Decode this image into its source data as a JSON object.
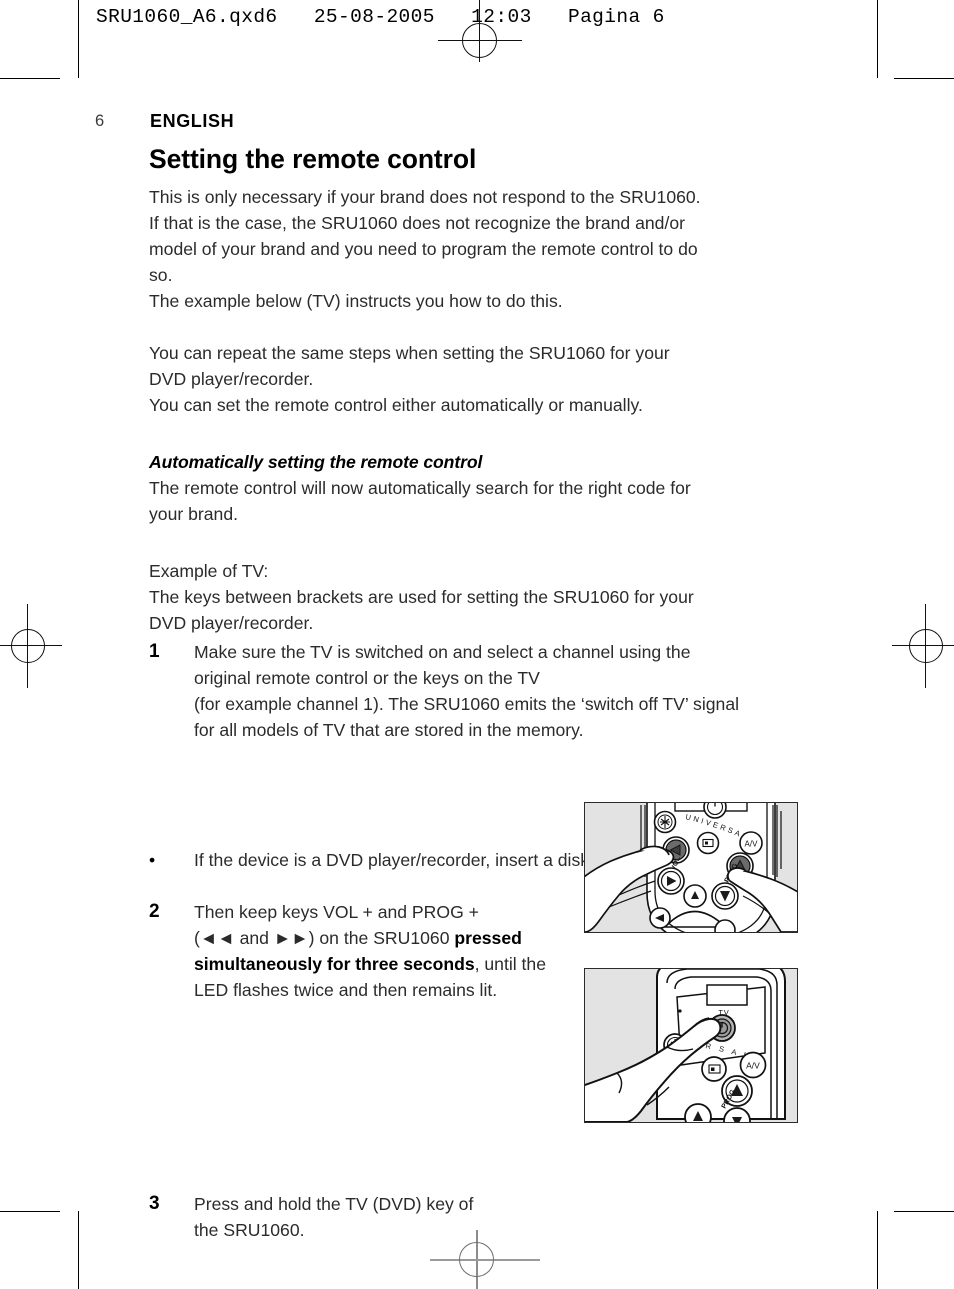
{
  "running_head": "SRU1060_A6.qxd6   25-08-2005   12:03   Pagina 6",
  "page": {
    "folio": "6",
    "language": "ENGLISH",
    "title": "Setting the remote control"
  },
  "body": {
    "intro_lines": [
      "This is only necessary if your brand does not respond to the SRU1060.",
      "If that is the case, the SRU1060 does not recognize the brand and/or",
      "model of your brand and you need to program the remote control to do",
      "so.",
      "The example below (TV) instructs you how to do this."
    ],
    "repeat_lines": [
      "You can repeat the same steps when setting the SRU1060 for your",
      "DVD player/recorder.",
      "You can set the remote control either automatically or manually."
    ],
    "subheading": "Automatically setting the remote control",
    "auto_lines": [
      "The remote control will now automatically search for the right code for",
      "your brand."
    ],
    "example_lines": [
      "Example of TV:",
      "The keys between brackets are used for setting the SRU1060 for your",
      "DVD player/recorder."
    ]
  },
  "steps": [
    {
      "marker": "1",
      "type": "number",
      "lines": [
        "Make sure the TV is switched on and select a channel using the",
        "original remote control or the keys on the TV",
        "(for example channel 1). The SRU1060 emits the ‘switch off TV’ signal",
        "for all models of TV that are stored in the memory."
      ]
    },
    {
      "marker": "•",
      "type": "bullet",
      "lines": [
        "If the device is a DVD player/recorder, insert a disk and start playback."
      ]
    },
    {
      "marker": "2",
      "type": "number",
      "narrow": true,
      "rich": [
        {
          "text": "Then keep keys VOL + and PROG +",
          "bold": false
        },
        {
          "text": "(◄◄ and ►►) on the SRU1060 ",
          "bold": false
        },
        {
          "text": "pressed",
          "bold": true
        },
        {
          "text": "simultaneously for three seconds",
          "bold": true
        },
        {
          "text": ", until the",
          "bold": false
        },
        {
          "text": "LED flashes twice and then remains lit.",
          "bold": false
        }
      ]
    },
    {
      "marker": "3",
      "type": "number",
      "narrow": true,
      "lines": [
        "Press and hold the TV (DVD) key of",
        "the SRU1060."
      ]
    }
  ],
  "figures": [
    {
      "name": "remote-two-hands-vol-prog",
      "alt": "Two hands holding the SRU1060 remote, thumbs pressing the VOL + and PROG + keys",
      "labels": {
        "brand": "UNIVERSAL",
        "vol": "VOL",
        "prog": "PROG",
        "av": "A/V"
      }
    },
    {
      "name": "remote-finger-tv-key",
      "alt": "A hand pressing and holding the TV key on the SRU1060 remote",
      "labels": {
        "tv": "TV",
        "brand": "R S A L",
        "prog": "PROG",
        "av": "A/V"
      }
    }
  ],
  "colors": {
    "page_background": "#ffffff",
    "text": "#2b2b2b",
    "heading": "#000000",
    "figure_background": "#e3e3e3",
    "figure_border": "#2a2a2a",
    "pressed_key_fill": "#6b6b6b"
  }
}
